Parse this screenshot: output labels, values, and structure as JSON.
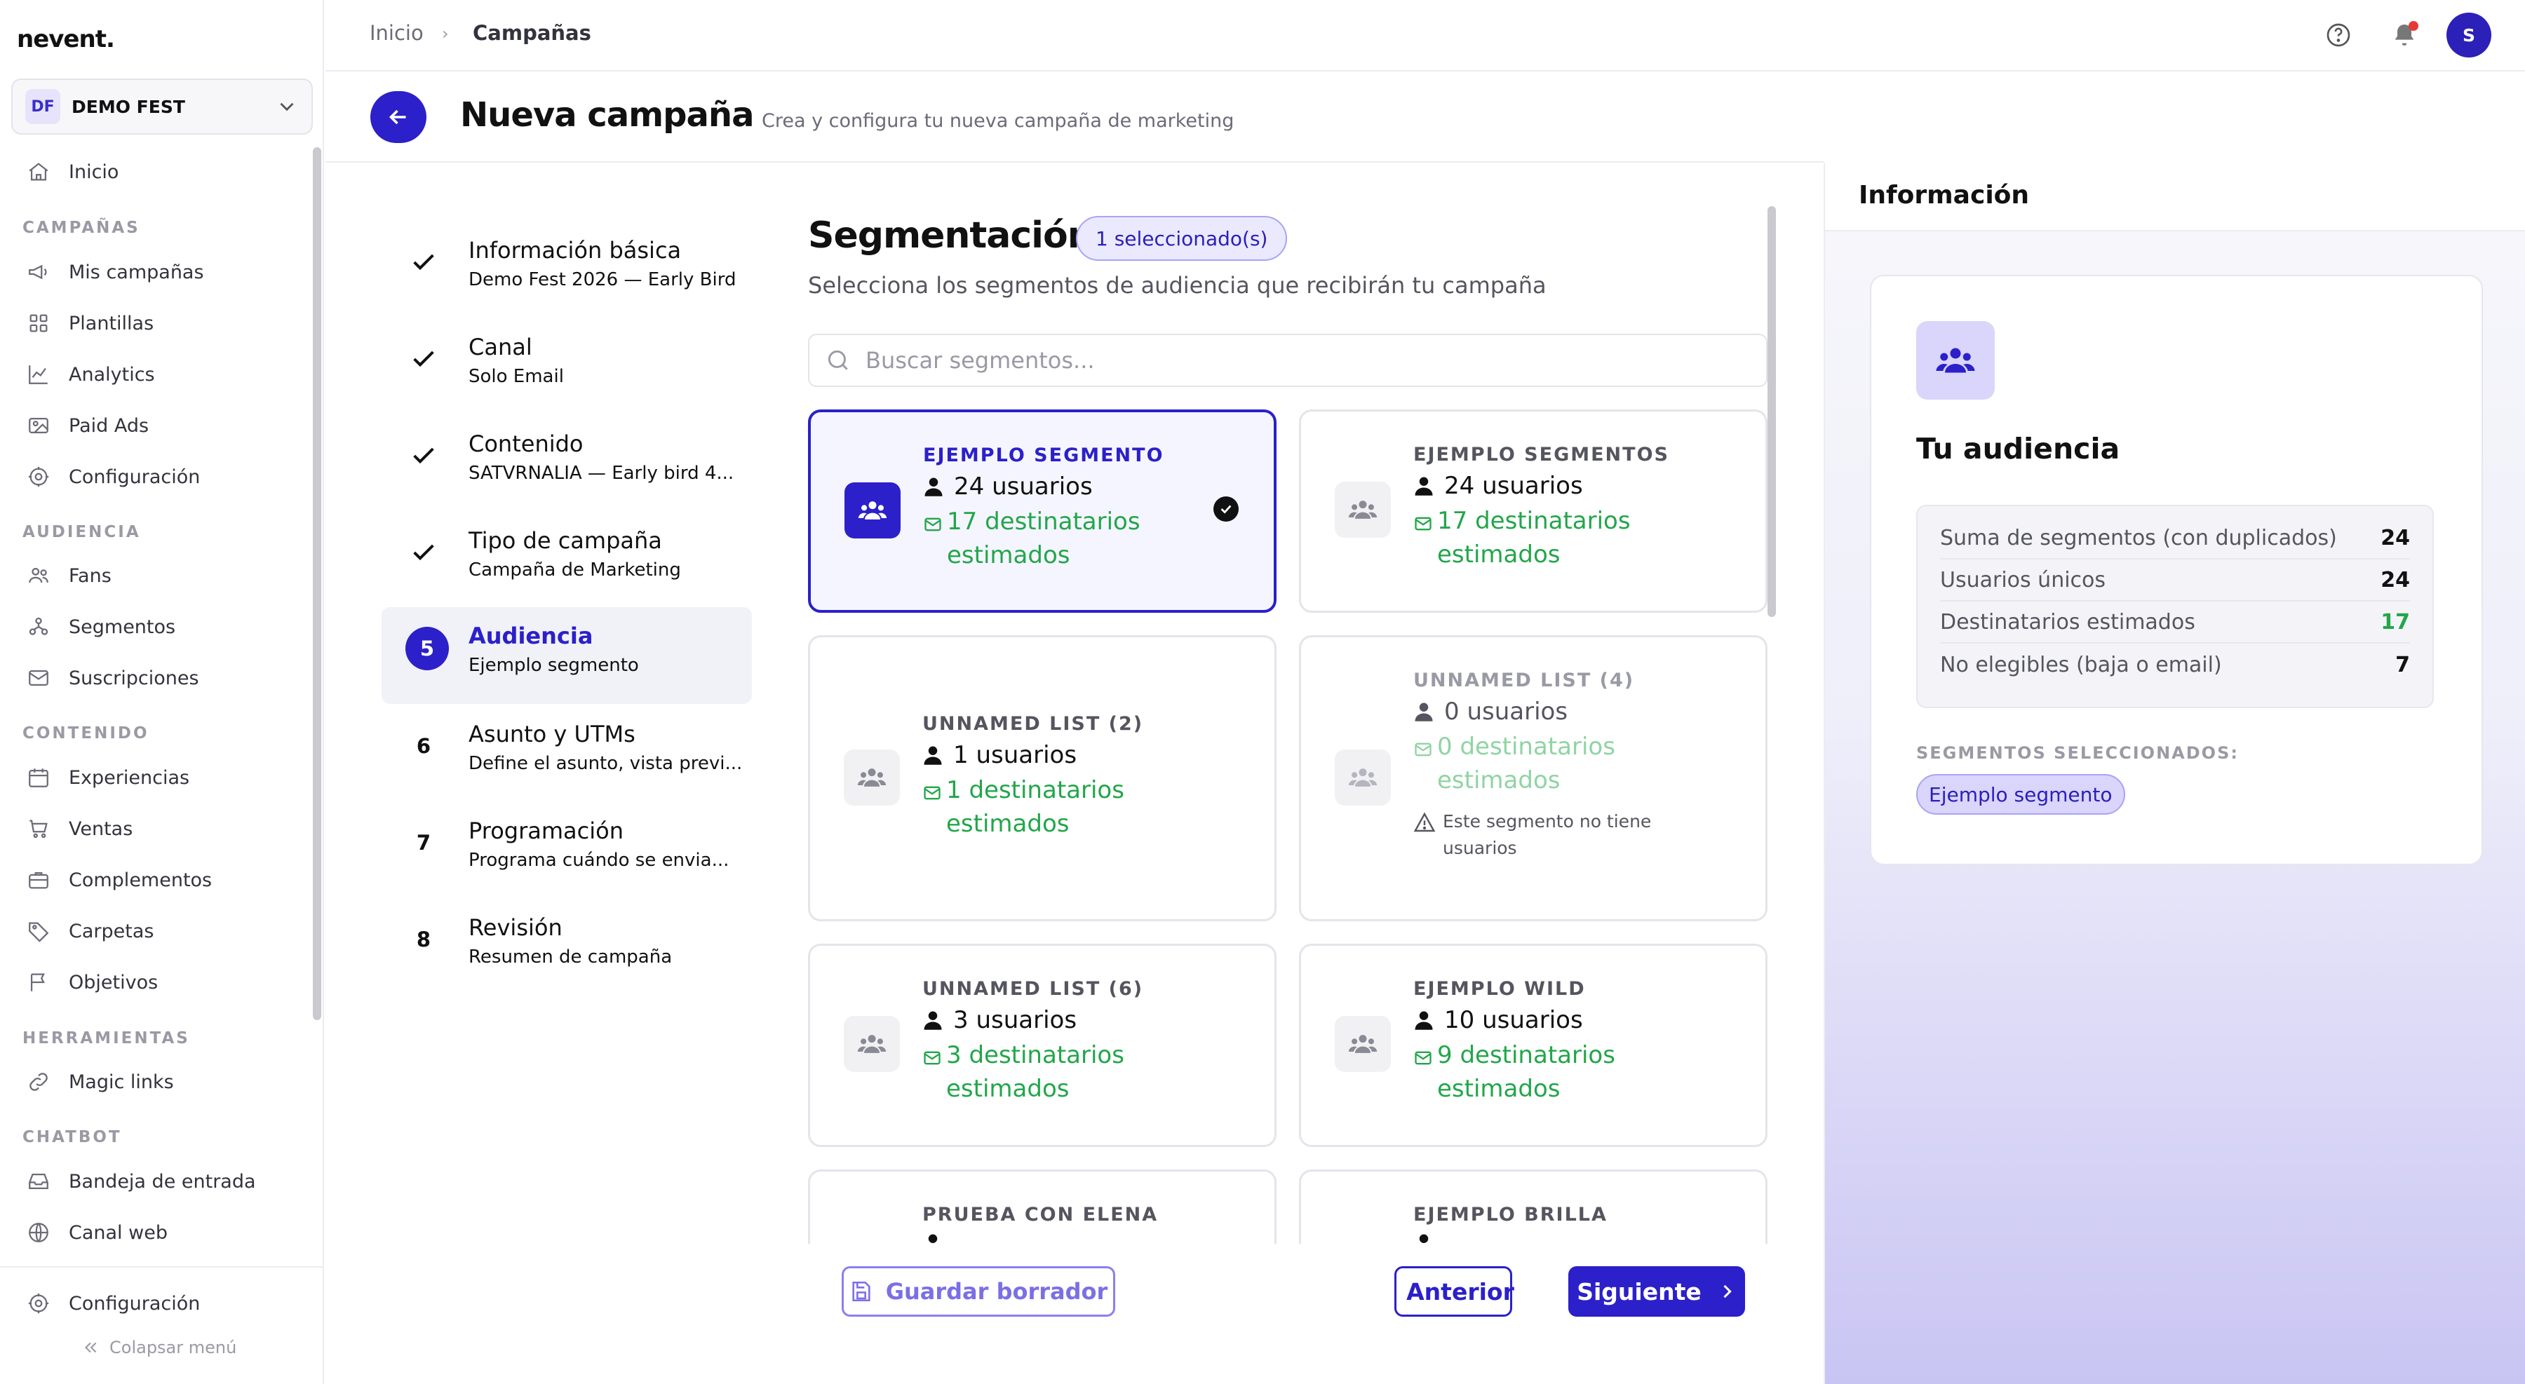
{
  "app": {
    "logo": "nevent."
  },
  "org": {
    "initials": "DF",
    "name": "DEMO FEST"
  },
  "sidebar": {
    "home": "Inicio",
    "sections": {
      "campaigns": "CAMPAÑAS",
      "audience": "AUDIENCIA",
      "content": "CONTENIDO",
      "tools": "HERRAMIENTAS",
      "chatbot": "CHATBOT"
    },
    "campaigns": [
      "Mis campañas",
      "Plantillas",
      "Analytics",
      "Paid Ads",
      "Configuración"
    ],
    "audience": [
      "Fans",
      "Segmentos",
      "Suscripciones"
    ],
    "content": [
      "Experiencias",
      "Ventas",
      "Complementos",
      "Carpetas",
      "Objetivos"
    ],
    "tools": [
      "Magic links"
    ],
    "chatbot": [
      "Bandeja de entrada",
      "Canal web"
    ],
    "settings": "Configuración",
    "collapse": "Colapsar menú"
  },
  "breadcrumb": {
    "home": "Inicio",
    "current": "Campañas"
  },
  "user": {
    "initial": "S"
  },
  "page": {
    "title": "Nueva campaña",
    "subtitle": "Crea y configura tu nueva campaña de marketing"
  },
  "steps": [
    {
      "title": "Información básica",
      "subtitle": "Demo Fest 2026 — Early Bird",
      "state": "done"
    },
    {
      "title": "Canal",
      "subtitle": "Solo Email",
      "state": "done"
    },
    {
      "title": "Contenido",
      "subtitle": "SATVRNALIA — Early bird 4...",
      "state": "done"
    },
    {
      "title": "Tipo de campaña",
      "subtitle": "Campaña de Marketing",
      "state": "done"
    },
    {
      "number": "5",
      "title": "Audiencia",
      "subtitle": "Ejemplo segmento",
      "state": "active"
    },
    {
      "number": "6",
      "title": "Asunto y UTMs",
      "subtitle": "Define el asunto, vista previ...",
      "state": "pending"
    },
    {
      "number": "7",
      "title": "Programación",
      "subtitle": "Programa cuándo se envia...",
      "state": "pending"
    },
    {
      "number": "8",
      "title": "Revisión",
      "subtitle": "Resumen de campaña",
      "state": "pending"
    }
  ],
  "segmentation": {
    "title": "Segmentación",
    "badge": "1 seleccionado(s)",
    "subtitle": "Selecciona los segmentos de audiencia que recibirán tu campaña",
    "search_placeholder": "Buscar segmentos...",
    "cards": [
      {
        "name": "EJEMPLO SEGMENTO",
        "users": "24 usuarios",
        "dest1": "17 destinatarios",
        "dest2": "estimados",
        "selected": true
      },
      {
        "name": "EJEMPLO SEGMENTOS",
        "users": "24 usuarios",
        "dest1": "17 destinatarios",
        "dest2": "estimados"
      },
      {
        "name": "UNNAMED LIST (2)",
        "users": "1 usuarios",
        "dest1": "1 destinatarios",
        "dest2": "estimados"
      },
      {
        "name": "UNNAMED LIST (4)",
        "users": "0 usuarios",
        "dest1": "0 destinatarios",
        "dest2": "estimados",
        "warning1": "Este segmento no tiene",
        "warning2": "usuarios",
        "muted": true
      },
      {
        "name": "UNNAMED LIST (6)",
        "users": "3 usuarios",
        "dest1": "3 destinatarios",
        "dest2": "estimados"
      },
      {
        "name": "EJEMPLO WILD",
        "users": "10 usuarios",
        "dest1": "9 destinatarios",
        "dest2": "estimados"
      },
      {
        "name": "PRUEBA CON ELENA"
      },
      {
        "name": "EJEMPLO BRILLA"
      }
    ]
  },
  "actions": {
    "draft": "Guardar borrador",
    "prev": "Anterior",
    "next": "Siguiente"
  },
  "info": {
    "title": "Información",
    "audience_title": "Tu audiencia",
    "stats": [
      {
        "label": "Suma de segmentos (con duplicados)",
        "value": "24"
      },
      {
        "label": "Usuarios únicos",
        "value": "24"
      },
      {
        "label": "Destinatarios estimados",
        "value": "17"
      },
      {
        "label": "No elegibles (baja o email)",
        "value": "7"
      }
    ],
    "selected_label": "SEGMENTOS SELECCIONADOS:",
    "selected_chip": "Ejemplo segmento"
  },
  "colors": {
    "accent": "#2b20c9",
    "success": "#22a64a"
  }
}
